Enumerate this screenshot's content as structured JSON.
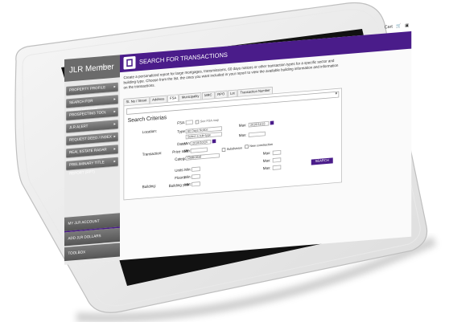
{
  "sidebar": {
    "brand": "JLR Member",
    "home": "Home",
    "items": [
      {
        "label": "Property profile"
      },
      {
        "label": "Search for transactions"
      },
      {
        "label": "Prospecting tool"
      },
      {
        "label": "JLR alert"
      },
      {
        "label": "Request deed / index"
      },
      {
        "label": "Real estate radar"
      },
      {
        "label": "Preliminary title report (RPT)"
      }
    ],
    "bottom": [
      {
        "label": "My JLR account"
      },
      {
        "label": "Add JLR dollars"
      },
      {
        "label": "Toolbox"
      }
    ]
  },
  "header": {
    "title": "Search for transactions"
  },
  "topright": {
    "cart": "Cart",
    "icons": [
      "cart-icon",
      "print-icon"
    ]
  },
  "intro": "Create a personalized report for large mortgages, transmissions, 60 days notices or other transaction types for a specific sector and building type. Choose from the list, the ones you want included in your report to view the available building information and information on the transactions.",
  "tabs": [
    "St. No / Street",
    "Address",
    "FSA",
    "Municipality",
    "MRC",
    "RPO",
    "Lot",
    "Transaction Number"
  ],
  "active_tab": "FSA",
  "form": {
    "title": "Search Criterias",
    "location_label": "Location:",
    "fsa_label": "FSA:",
    "fsa_map": "See FSA map",
    "transaction_label": "Transaction:",
    "type_label": "Type:",
    "type_value": "60 Days Notice",
    "subtype_value": "Select a sub-type",
    "date_label": "Date:",
    "min_label": "Min:",
    "max_label": "Max:",
    "date_min": "2018/10/24",
    "date_max": "2018/11/23",
    "price_label": "Price sold:",
    "category_label": "Category:",
    "category_value": "Optional",
    "subdivision": "Subdivision",
    "new_construction": "New construction",
    "building_label": "Building:",
    "units_label": "Units:",
    "floors_label": "Floors:",
    "year_label": "Building year:",
    "search_button": "SEARCH"
  },
  "colors": {
    "accent": "#4a1c8a",
    "sidebar_button": "#6f6f6f"
  }
}
